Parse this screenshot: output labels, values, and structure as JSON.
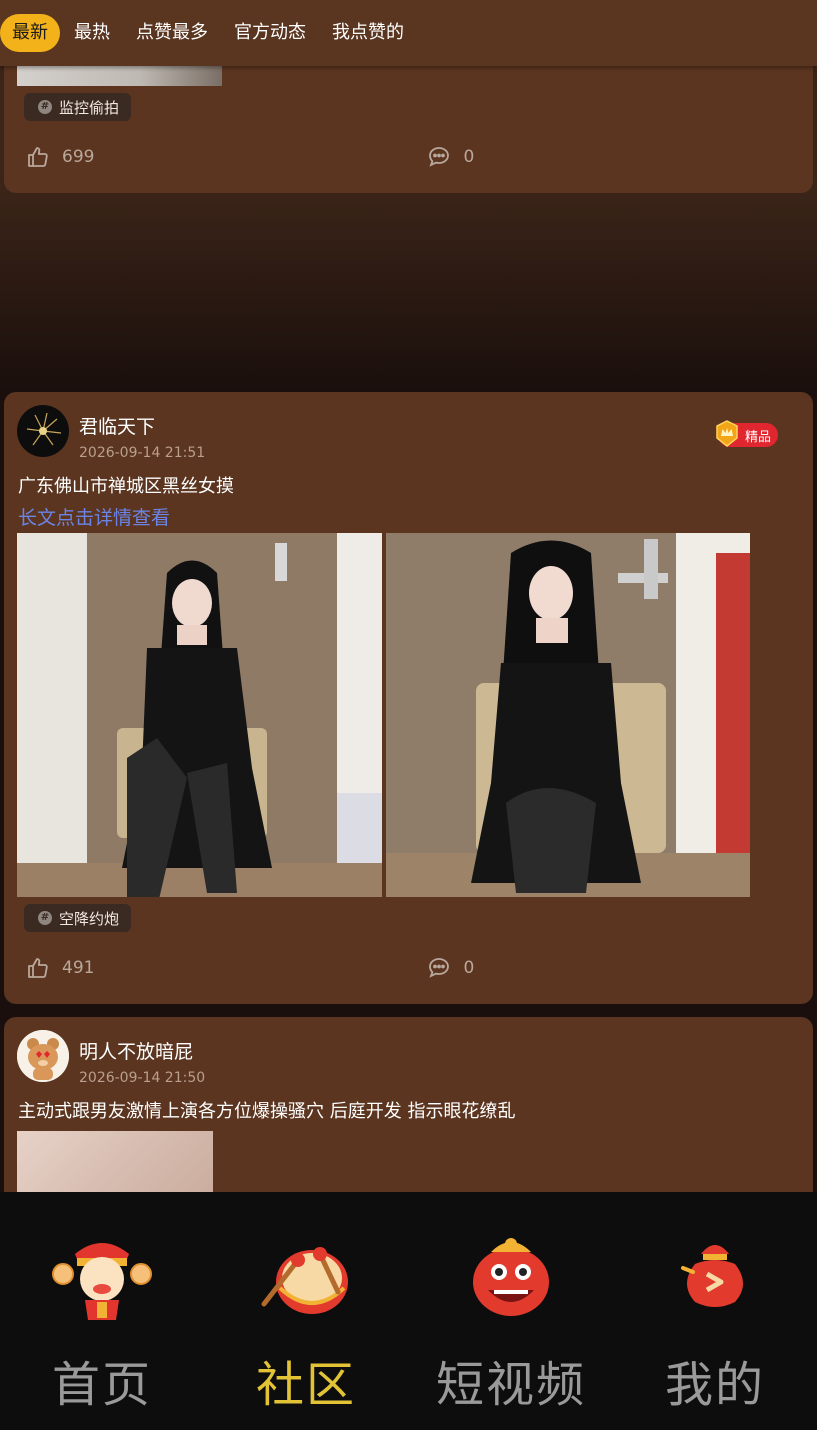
{
  "tabs": [
    {
      "label": "最新",
      "active": true
    },
    {
      "label": "最热"
    },
    {
      "label": "点赞最多"
    },
    {
      "label": "官方动态"
    },
    {
      "label": "我点赞的"
    }
  ],
  "posts": [
    {
      "tag": "监控偷拍",
      "likes": "699",
      "comments": "0"
    },
    {
      "username": "君临天下",
      "time": "2026-09-14 21:51",
      "badge": "精品",
      "content": "广东佛山市禅城区黑丝女摸",
      "more_link": "长文点击详情查看",
      "tag": "空降约炮",
      "likes": "491",
      "comments": "0"
    },
    {
      "username": "明人不放暗屁",
      "time": "2026-09-14 21:50",
      "content": "主动式跟男友激情上演各方位爆操骚穴 后庭开发 指示眼花缭乱"
    }
  ],
  "bottom_nav": [
    {
      "label": "首页",
      "icon": "fortune-god-icon"
    },
    {
      "label": "社区",
      "icon": "drum-icon",
      "active": true
    },
    {
      "label": "短视频",
      "icon": "lion-dance-icon"
    },
    {
      "label": "我的",
      "icon": "lucky-bag-icon"
    }
  ],
  "colors": {
    "card_bg": "#5b3520",
    "active_tab": "#f3b21a",
    "link": "#6b84e6",
    "active_nav": "#e3c336",
    "badge": "#e0262e"
  }
}
